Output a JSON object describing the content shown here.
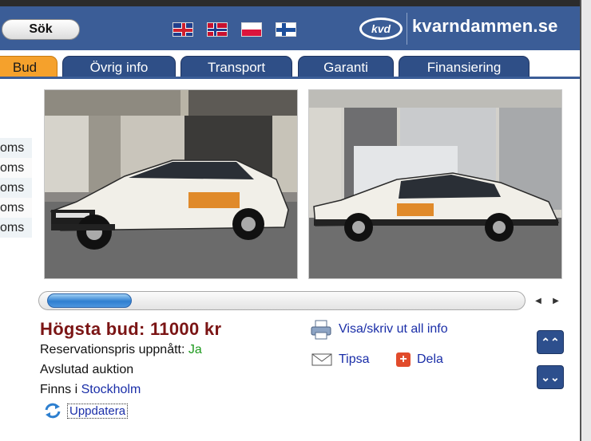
{
  "header": {
    "search_label": "Sök",
    "flags": [
      "uk-flag-icon",
      "norway-flag-icon",
      "poland-flag-icon",
      "finland-flag-icon"
    ],
    "logo_text": "kvd",
    "site_name": "kvarndammen.se"
  },
  "tabs": [
    {
      "label": "Bud",
      "active": true
    },
    {
      "label": "Övrig info",
      "active": false
    },
    {
      "label": "Transport",
      "active": false
    },
    {
      "label": "Garanti",
      "active": false
    },
    {
      "label": "Finansiering",
      "active": false
    }
  ],
  "left_prices": [
    "oms",
    "oms",
    "oms",
    "oms",
    "oms"
  ],
  "photos": [
    "car-photo-front",
    "car-photo-side"
  ],
  "auction": {
    "highest_bid": "Högsta bud: 11000 kr",
    "reserve_label": "Reservationspris uppnått: ",
    "reserve_value": "Ja",
    "status": "Avslutad auktion",
    "location_label": "Finns i ",
    "location_link": "Stockholm",
    "refresh_label": "Uppdatera"
  },
  "actions": {
    "print_label": "Visa/skriv ut all info",
    "tip_label": "Tipsa",
    "share_label": "Dela"
  },
  "scrollbar": {
    "position_fraction": 0.0
  },
  "colors": {
    "header_blue": "#3b5d97",
    "active_tab": "#f5a12c",
    "bid_red": "#7b1515",
    "link_blue": "#1a2ea8",
    "yes_green": "#1e9a1e"
  }
}
